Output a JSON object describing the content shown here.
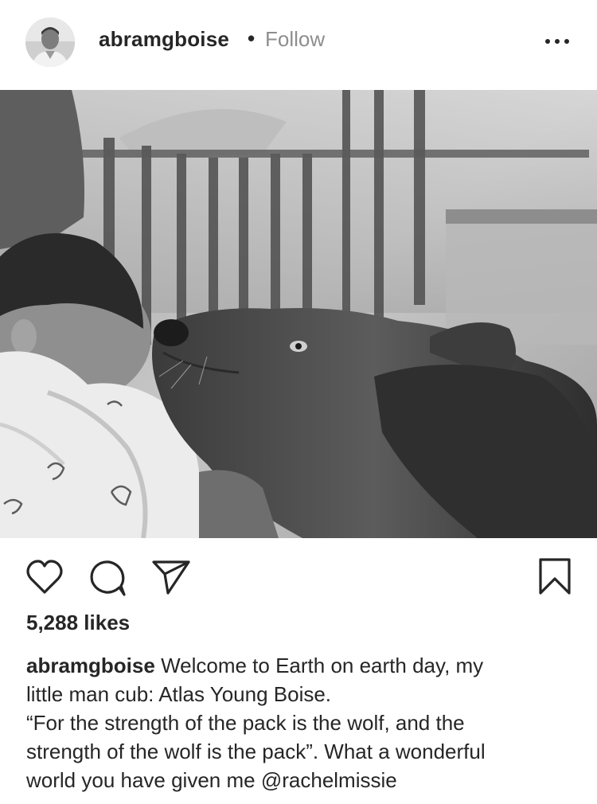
{
  "post": {
    "username": "abramgboise",
    "separator": "•",
    "follow_label": "Follow",
    "likes_text": "5,288 likes",
    "caption": {
      "username": "abramgboise",
      "line1": "Welcome to Earth on earth day, my",
      "line2": "little man cub: Atlas Young Boise.",
      "quote_line1": "“For the strength of the pack is the wolf, and the",
      "quote_line2": "strength of the wolf is the pack”. What a wonderful",
      "quote_line3_prefix": "world you have given me",
      "mention": "@rachelmissie"
    }
  },
  "icons": {
    "more": "more-options-icon",
    "like": "heart-icon",
    "comment": "comment-icon",
    "share": "send-icon",
    "save": "bookmark-icon"
  },
  "colors": {
    "text": "#262626",
    "muted": "#8e8e8e",
    "background": "#ffffff"
  }
}
